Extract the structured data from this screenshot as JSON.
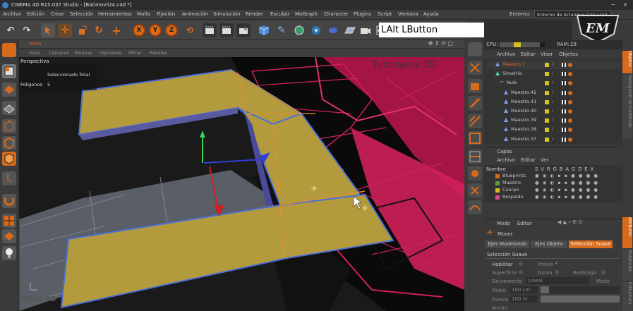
{
  "window": {
    "title": "CINEMA 4D R15.037 Studio - [Batimovil24.c4d *]"
  },
  "menubar": {
    "items": [
      "Archivo",
      "Edición",
      "Crear",
      "Selección",
      "Herramientas",
      "Malla",
      "Fijación",
      "Animación",
      "Simulación",
      "Render",
      "Esculpir",
      "MoGraph",
      "Character",
      "Plugins",
      "Script",
      "Ventana",
      "Ayuda"
    ],
    "environment_label": "Entorno:",
    "environment_value": "Entorno de Arranque (Usuario)"
  },
  "toolbar": {
    "axes": [
      "X",
      "Y",
      "Z"
    ],
    "hint_text": "LAlt LButton",
    "logo_text": "EM"
  },
  "viewport": {
    "panel_title": "Vista",
    "menu": [
      "Vista",
      "Cámaras",
      "Mostrar",
      "Opciones",
      "Filtrar",
      "Paneles"
    ],
    "projection": "Perspectiva",
    "hud_selected_label": "Seleccionado Total",
    "hud_polys_label": "Polígonos",
    "hud_polys_value": "5",
    "watermark": "Tutoriales 3D"
  },
  "status": {
    "cpu_label": "CPU:",
    "cpu_value": "88%",
    "ram_label": "RAM:",
    "ram_value": "29"
  },
  "objects": {
    "menu": [
      "Archivo",
      "Editar",
      "Visor",
      "Objetos"
    ],
    "rows": [
      {
        "name": "Maestro.1",
        "indent": 1,
        "selected": true
      },
      {
        "name": "Simetría",
        "indent": 1,
        "selected": false
      },
      {
        "name": "Nulo",
        "indent": 2,
        "selected": false
      },
      {
        "name": "Maestro.42",
        "indent": 3,
        "selected": false
      },
      {
        "name": "Maestro.41",
        "indent": 3,
        "selected": false
      },
      {
        "name": "Maestro.40",
        "indent": 3,
        "selected": false
      },
      {
        "name": "Maestro.39",
        "indent": 3,
        "selected": false
      },
      {
        "name": "Maestro.38",
        "indent": 3,
        "selected": false
      },
      {
        "name": "Maestro.37",
        "indent": 3,
        "selected": false
      }
    ]
  },
  "layers": {
    "title": "Capas",
    "menu": [
      "Archivo",
      "Editar",
      "Ver"
    ],
    "header": "Nombre",
    "columns": [
      "S",
      "V",
      "R",
      "G",
      "B",
      "A",
      "G",
      "D",
      "E",
      "X"
    ],
    "rows": [
      {
        "name": "Blueprints",
        "color": "#d86a1c"
      },
      {
        "name": "Maestro",
        "color": "#5a9e3c"
      },
      {
        "name": "Cuerpo",
        "color": "#d0c020"
      },
      {
        "name": "Respaldo",
        "color": "#d84a8a"
      }
    ]
  },
  "attributes": {
    "menu": [
      "Modo",
      "Editar"
    ],
    "tool": "Mover",
    "tabs": [
      "Ejes Modelando",
      "Ejes Objeto",
      "Selección Suave"
    ],
    "active_tab": "Selección Suave",
    "section": "Selección Suave",
    "habilitar_label": "Habilitar",
    "previo_label": "Previo",
    "superficie_label": "Superficie",
    "goma_label": "Goma",
    "restringir_label": "Restringir",
    "decremento_label": "Decremento",
    "decremento_value": "Lineal",
    "modo_label": "Modo",
    "radio_label": "Radio",
    "radio_value": "100 cm",
    "fuerza_label": "Fuerza",
    "fuerza_value": "100 %",
    "ancho_label": "Ancho"
  },
  "side_tabs": [
    "Objetos",
    "Navegador de Contenido",
    "Atributos",
    "Materiales",
    "Estructura"
  ],
  "colors": {
    "accent": "#d86a1c",
    "selection_blue": "#4a6fd8",
    "poly_yellow": "#b39a3c",
    "blueprint_red": "#d0205a"
  }
}
